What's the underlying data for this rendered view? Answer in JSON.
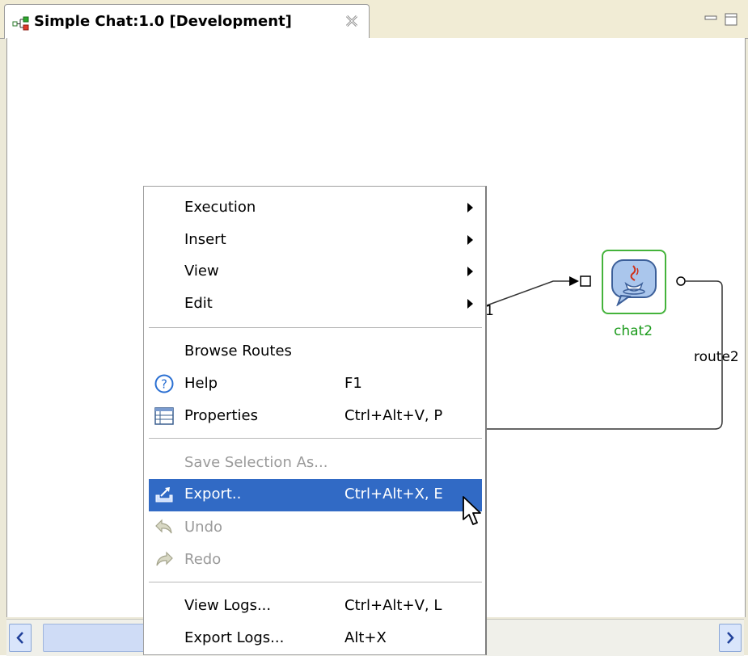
{
  "editor": {
    "tab_title": "Simple Chat:1.0 [Development]"
  },
  "diagram": {
    "node_label": "chat2",
    "route_label": "route2",
    "partial_label": "1"
  },
  "context_menu": {
    "items": [
      {
        "label": "Execution",
        "submenu": true
      },
      {
        "label": "Insert",
        "submenu": true
      },
      {
        "label": "View",
        "submenu": true
      },
      {
        "label": "Edit",
        "submenu": true
      },
      {
        "label": "Browse Routes"
      },
      {
        "label": "Help",
        "accel": "F1",
        "icon": "help-icon"
      },
      {
        "label": "Properties",
        "accel": "Ctrl+Alt+V, P",
        "icon": "properties-icon"
      },
      {
        "label": "Save Selection As...",
        "disabled": true
      },
      {
        "label": "Export..",
        "accel": "Ctrl+Alt+X, E",
        "icon": "export-icon",
        "selected": true
      },
      {
        "label": "Undo",
        "disabled": true,
        "icon": "undo-icon"
      },
      {
        "label": "Redo",
        "disabled": true,
        "icon": "redo-icon"
      },
      {
        "label": "View Logs...",
        "accel": "Ctrl+Alt+V, L"
      },
      {
        "label": "Export Logs...",
        "accel": "Alt+X"
      }
    ]
  },
  "colors": {
    "selection": "#316ac5",
    "node_border": "#44b33b",
    "node_label": "#1a9a1a"
  }
}
